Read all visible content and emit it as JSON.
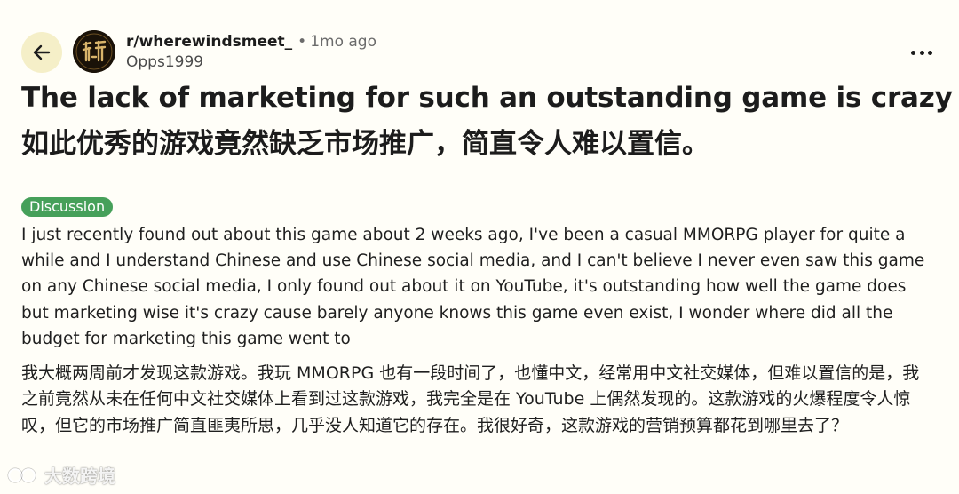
{
  "header": {
    "back_icon": "arrow-left-icon",
    "avatar_icon": "subreddit-avatar",
    "subreddit": "r/wherewindsmeet_",
    "separator": "•",
    "age": "1mo ago",
    "author": "Opps1999",
    "more_icon": "more-horizontal-icon"
  },
  "post": {
    "title_en": "The lack of marketing for such an outstanding game is crazy",
    "title_zh": "如此优秀的游戏竟然缺乏市场推广，简直令人难以置信。",
    "flair": "Discussion",
    "body_en": "I just recently found out about this game about 2 weeks ago, I've been a casual MMORPG player for quite a while and I understand Chinese and use Chinese social media, and I can't believe I never even saw this game on any Chinese social media, I only found out about it on YouTube, it's outstanding how well the game does but marketing wise it's crazy cause barely anyone knows this game even exist, I wonder where did all the budget for marketing this game went to",
    "body_zh": "我大概两周前才发现这款游戏。我玩 MMORPG 也有一段时间了，也懂中文，经常用中文社交媒体，但难以置信的是，我之前竟然从未在任何中文社交媒体上看到过这款游戏，我完全是在 YouTube 上偶然发现的。这款游戏的火爆程度令人惊叹，但它的市场推广简直匪夷所思，几乎没人知道它的存在。我很好奇，这款游戏的营销预算都花到哪里去了？"
  },
  "watermark": {
    "text": "大数跨境"
  },
  "colors": {
    "background": "#fffef8",
    "back_button_bg": "#f5efc8",
    "flair_bg": "#46a05a",
    "text": "#1c1c1c",
    "muted": "#6b6b6b"
  }
}
